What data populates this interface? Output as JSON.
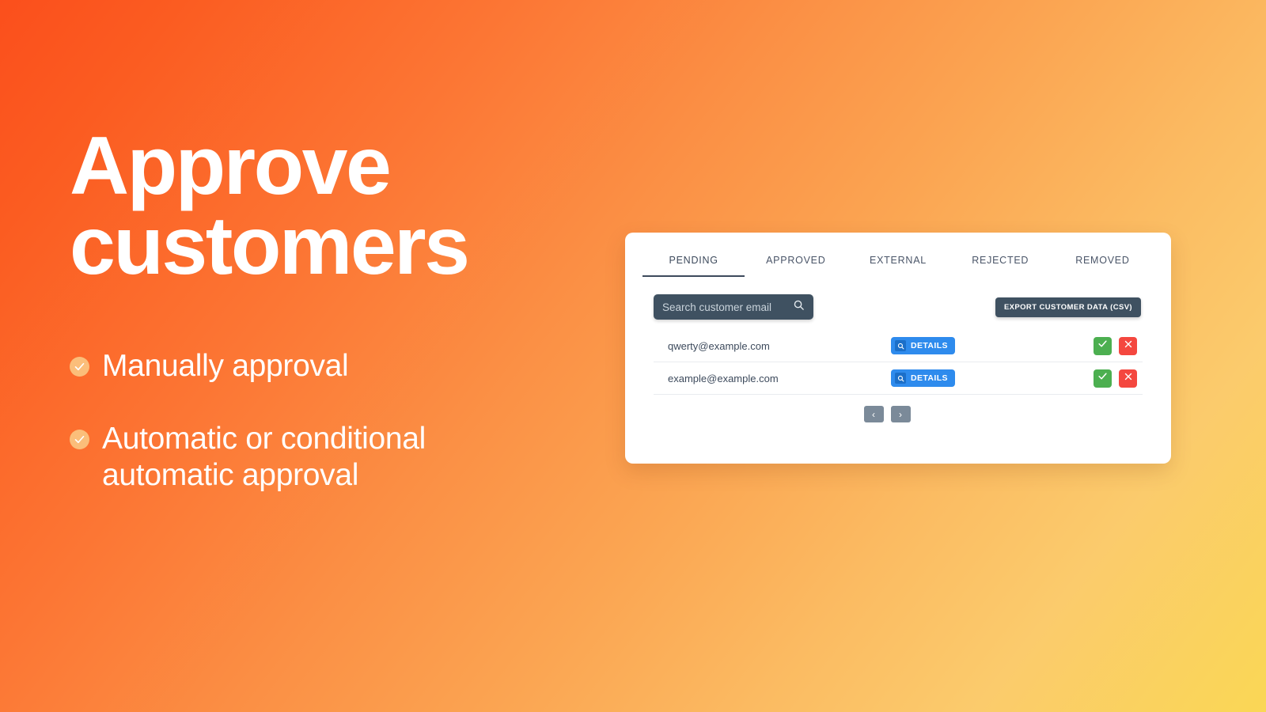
{
  "hero": {
    "headline": "Approve\ncustomers",
    "bullets": [
      {
        "icon": "check-circle-icon",
        "text": "Manually approval"
      },
      {
        "icon": "check-circle-icon",
        "text": "Automatic or conditional\nautomatic approval"
      }
    ]
  },
  "card": {
    "tabs": [
      {
        "label": "PENDING",
        "active": true
      },
      {
        "label": "APPROVED",
        "active": false
      },
      {
        "label": "EXTERNAL",
        "active": false
      },
      {
        "label": "REJECTED",
        "active": false
      },
      {
        "label": "REMOVED",
        "active": false
      }
    ],
    "toolbar": {
      "search_value": "",
      "search_placeholder": "Search customer email",
      "search_icon": "search-icon",
      "export_label": "EXPORT CUSTOMER DATA (CSV)"
    },
    "rows": [
      {
        "email": "qwerty@example.com",
        "details_label": "DETAILS",
        "details_icon": "magnifier-icon",
        "approve_icon": "check-icon",
        "reject_icon": "cross-icon"
      },
      {
        "email": "example@example.com",
        "details_label": "DETAILS",
        "details_icon": "magnifier-icon",
        "approve_icon": "check-icon",
        "reject_icon": "cross-icon"
      }
    ],
    "pagination": {
      "prev_label": "‹",
      "next_label": "›"
    }
  },
  "colors": {
    "bg_start": "#fb4f1c",
    "bg_end": "#fad755",
    "card_bg": "#ffffff",
    "dark_slate": "#3f5161",
    "details_blue": "#2e8bed",
    "approve_green": "#4caf50",
    "reject_red": "#f4473f",
    "bullet_amber": "#fbbe7a",
    "page_gray": "#7b8a99"
  }
}
